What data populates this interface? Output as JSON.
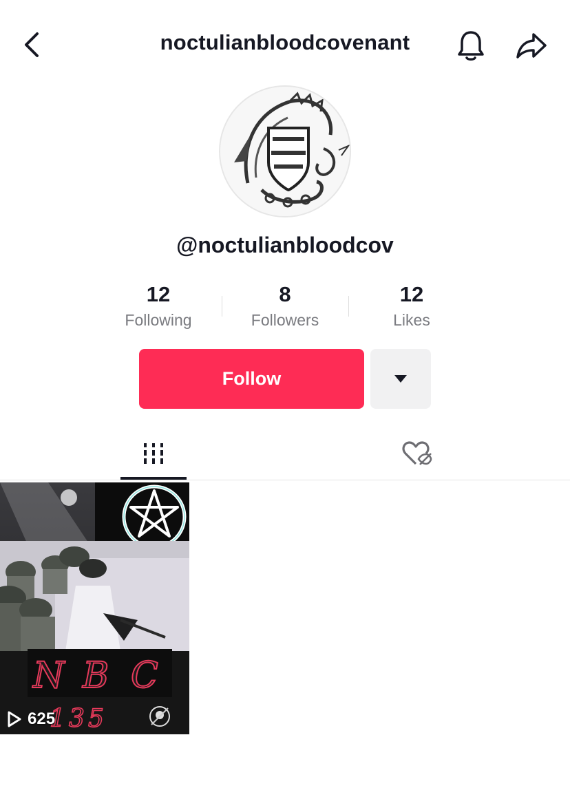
{
  "header": {
    "title": "noctulianbloodcovenant",
    "back_icon": "chevron-left-icon",
    "bell_icon": "bell-icon",
    "share_icon": "share-arrow-icon"
  },
  "profile": {
    "username": "@noctulianbloodcov",
    "avatar_description_icon": "dragon-crest-avatar"
  },
  "stats": [
    {
      "value": "12",
      "label": "Following"
    },
    {
      "value": "8",
      "label": "Followers"
    },
    {
      "value": "12",
      "label": "Likes"
    }
  ],
  "actions": {
    "follow_label": "Follow",
    "more_icon": "caret-down-icon"
  },
  "tabs": {
    "videos_icon": "grid-bars-icon",
    "liked_icon": "heart-hidden-icon"
  },
  "videos": [
    {
      "views": "625",
      "play_icon": "play-outline-icon"
    }
  ],
  "colors": {
    "accent": "#fe2c55",
    "text_primary": "#161823",
    "text_secondary": "#7a7b80",
    "secondary_button_bg": "#f1f1f2"
  }
}
